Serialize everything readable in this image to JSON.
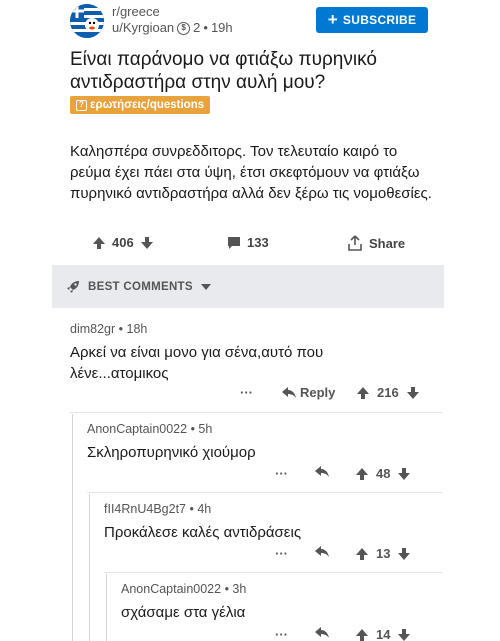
{
  "post": {
    "subreddit": "r/greece",
    "author": "u/Kyrgioan",
    "awards": "2",
    "age": "19h",
    "subscribe_label": "SUBSCRIBE",
    "title": "Είναι παράνομο να φτιάξω πυρηνικό αντιδραστήρα στην αυλή μου?",
    "flair": "ερωτήσεις/questions",
    "body": "Καλησπέρα συνρεδδιτορς. Τον τελευταίο καιρό το ρεύμα έχει πάει στα ύψη, έτσι σκεφτόμουν να φτιάξω πυρηνικό αντιδραστήρα αλλά δεν ξέρω τις νομοθεσίες.",
    "votes": "406",
    "comments": "133",
    "share_label": "Share"
  },
  "sort": {
    "label": "BEST COMMENTS"
  },
  "comments": [
    {
      "author": "dim82gr",
      "age": "18h",
      "text": "Αρκεί να είναι μονο για σένα,αυτό που λένε...ατομικος",
      "more": "···",
      "reply_label": "Reply",
      "votes": "216"
    },
    {
      "author": "AnonCaptain0022",
      "age": "5h",
      "text": "Σκληροπυρηνικό χιούμορ",
      "more": "···",
      "votes": "48"
    },
    {
      "author": "fII4RnU4Bg2t7",
      "age": "4h",
      "text": "Προκάλεσε καλές αντιδράσεις",
      "more": "···",
      "votes": "13"
    },
    {
      "author": "AnonCaptain0022",
      "age": "3h",
      "text": "σχάσαμε στα γέλια",
      "more": "···",
      "votes": "14"
    }
  ],
  "colors": {
    "accent": "#0079d3",
    "flair": "#e8a33c",
    "bar": "#e9eaee"
  }
}
